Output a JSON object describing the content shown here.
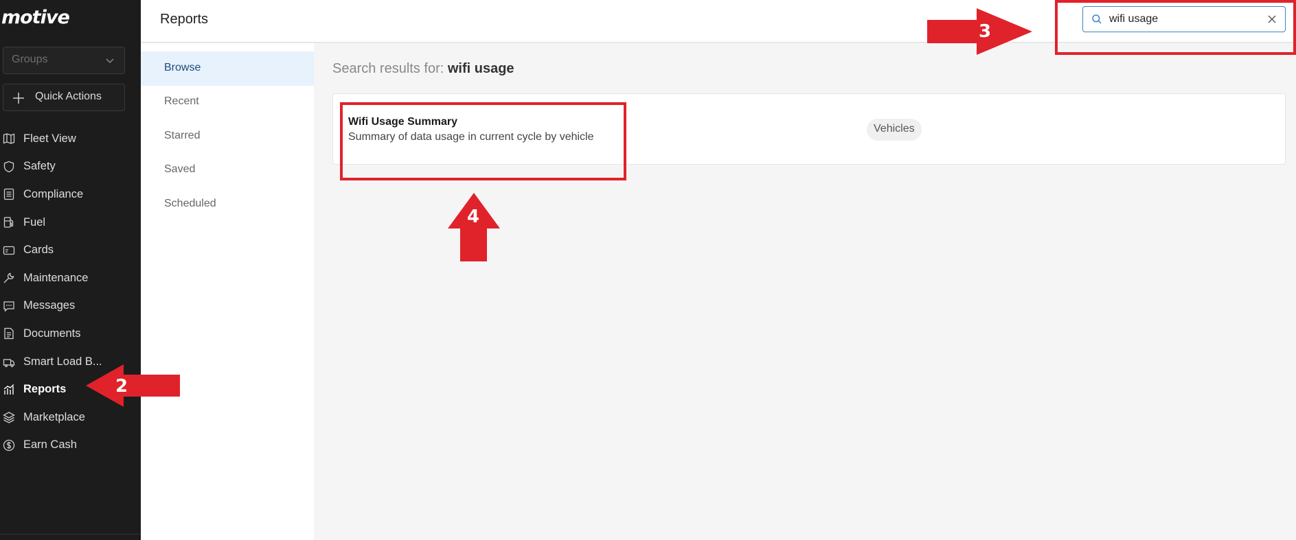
{
  "sidebar": {
    "logo": "motive",
    "groups_placeholder": "Groups",
    "quick_actions": "Quick Actions",
    "items": [
      {
        "label": "Fleet View",
        "icon": "map-icon"
      },
      {
        "label": "Safety",
        "icon": "shield-icon"
      },
      {
        "label": "Compliance",
        "icon": "list-icon"
      },
      {
        "label": "Fuel",
        "icon": "fuel-icon"
      },
      {
        "label": "Cards",
        "icon": "card-icon"
      },
      {
        "label": "Maintenance",
        "icon": "wrench-icon"
      },
      {
        "label": "Messages",
        "icon": "message-icon"
      },
      {
        "label": "Documents",
        "icon": "document-icon"
      },
      {
        "label": "Smart Load B...",
        "icon": "load-board-icon"
      },
      {
        "label": "Reports",
        "icon": "reports-icon",
        "active": true
      },
      {
        "label": "Marketplace",
        "icon": "layers-icon"
      },
      {
        "label": "Earn Cash",
        "icon": "dollar-icon"
      }
    ]
  },
  "header": {
    "title": "Reports",
    "search_value": "wifi usage"
  },
  "subnav": {
    "items": [
      "Browse",
      "Recent",
      "Starred",
      "Saved",
      "Scheduled"
    ],
    "active": "Browse"
  },
  "main": {
    "results_prefix": "Search results for:",
    "results_query": "wifi usage",
    "results": [
      {
        "title": "Wifi Usage Summary",
        "description": "Summary of data usage in current cycle by vehicle",
        "tag": "Vehicles"
      }
    ]
  },
  "annotations": {
    "step2": "2",
    "step3": "3",
    "step4": "4",
    "color": "#e0222b"
  },
  "colors": {
    "sidebar_bg": "#1c1c1c",
    "accent": "#3b82c4",
    "active_subnav_bg": "#e7f2fd"
  }
}
